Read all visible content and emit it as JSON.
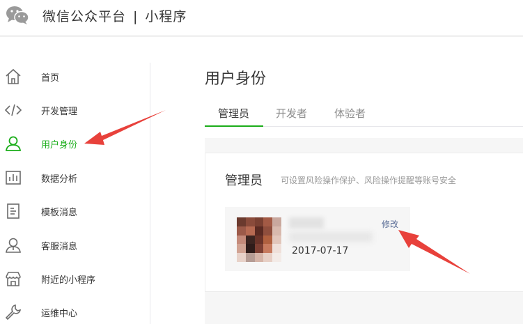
{
  "header": {
    "brand": "微信公众平台",
    "separator": "|",
    "product": "小程序",
    "logo_icon": "wechat-logo-icon"
  },
  "sidebar": {
    "items": [
      {
        "label": "首页",
        "icon": "home-icon",
        "active": false
      },
      {
        "label": "开发管理",
        "icon": "code-icon",
        "active": false
      },
      {
        "label": "用户身份",
        "icon": "user-icon",
        "active": true
      },
      {
        "label": "数据分析",
        "icon": "chart-icon",
        "active": false
      },
      {
        "label": "模板消息",
        "icon": "document-icon",
        "active": false
      },
      {
        "label": "客服消息",
        "icon": "support-icon",
        "active": false
      },
      {
        "label": "附近的小程序",
        "icon": "store-icon",
        "active": false
      },
      {
        "label": "运维中心",
        "icon": "wrench-icon",
        "active": false
      }
    ]
  },
  "main": {
    "title": "用户身份",
    "tabs": [
      {
        "label": "管理员",
        "active": true
      },
      {
        "label": "开发者",
        "active": false
      },
      {
        "label": "体验者",
        "active": false
      }
    ],
    "card": {
      "title": "管理员",
      "description": "可设置风险操作保护、风险操作提醒等账号安全",
      "admin": {
        "date": "2017-07-17",
        "edit_label": "修改"
      }
    }
  },
  "colors": {
    "accent": "#1aad19",
    "link": "#576b95",
    "annotation_arrow": "#e8413b"
  }
}
